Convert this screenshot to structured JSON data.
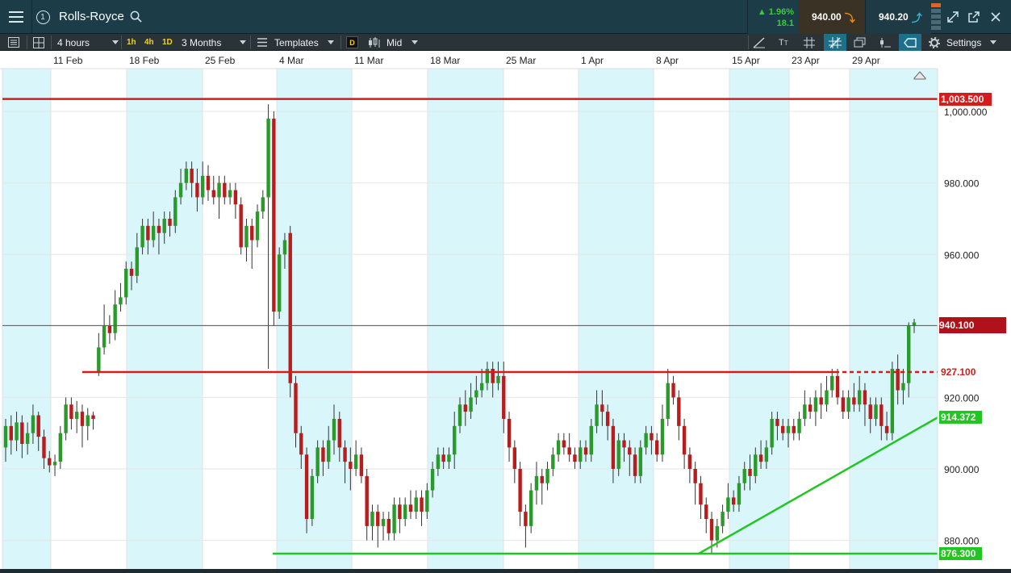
{
  "header": {
    "title": "Rolls-Royce",
    "panel_number": "1",
    "change_pct": "1.96%",
    "change_abs": "18.1",
    "sell_price": "940.00",
    "buy_price": "940.20"
  },
  "toolbar": {
    "timeframe": "4 hours",
    "quick_1h": "1h",
    "quick_4h": "4h",
    "quick_1d": "1D",
    "range": "3 Months",
    "templates": "Templates",
    "d_badge": "D",
    "price_type": "Mid",
    "settings": "Settings"
  },
  "colors": {
    "up": "#2a9a2a",
    "down": "#b91c1c",
    "resistance": "#d71a1a",
    "support": "#22c622",
    "band": "#d9f6fb"
  },
  "chart_data": {
    "type": "candlestick",
    "x_tick_labels": [
      "11 Feb",
      "18 Feb",
      "25 Feb",
      "4 Mar",
      "11 Mar",
      "18 Mar",
      "25 Mar",
      "1 Apr",
      "8 Apr",
      "15 Apr",
      "23 Apr",
      "29 Apr"
    ],
    "y_tick_labels": [
      "880.000",
      "900.000",
      "920.000",
      "940.000",
      "960.000",
      "980.000",
      "1,000.000"
    ],
    "ylim": [
      872,
      1012
    ],
    "current_price": "940.100",
    "level_labels": {
      "top_resistance": "1,003.500",
      "mid_resistance": "927.100",
      "trendline": "914.372",
      "support": "876.300"
    },
    "levels": {
      "top_resistance": 1003.5,
      "mid_resistance": 927.1,
      "support": 876.3,
      "current": 940.1
    },
    "trendline": [
      [
        167,
        876.3
      ],
      [
        230,
        914.372
      ]
    ],
    "candles": [
      [
        906,
        912,
        902,
        914
      ],
      [
        912,
        908,
        904,
        915
      ],
      [
        908,
        913,
        905,
        916
      ],
      [
        913,
        907,
        903,
        915
      ],
      [
        907,
        910,
        904,
        913
      ],
      [
        910,
        915,
        907,
        918
      ],
      [
        915,
        909,
        905,
        916
      ],
      [
        909,
        903,
        900,
        911
      ],
      [
        903,
        901,
        899,
        905
      ],
      [
        901,
        902,
        898,
        904
      ],
      [
        902,
        910,
        900,
        912
      ],
      [
        910,
        918,
        908,
        920
      ],
      [
        918,
        914,
        911,
        920
      ],
      [
        914,
        916,
        910,
        919
      ],
      [
        916,
        912,
        906,
        918
      ],
      [
        912,
        915,
        908,
        917
      ],
      [
        915,
        914,
        911,
        916
      ],
      [
        927,
        934,
        926,
        938
      ],
      [
        934,
        940,
        932,
        946
      ],
      [
        940,
        938,
        935,
        943
      ],
      [
        938,
        946,
        936,
        950
      ],
      [
        946,
        948,
        944,
        952
      ],
      [
        948,
        956,
        946,
        958
      ],
      [
        956,
        954,
        950,
        958
      ],
      [
        954,
        962,
        952,
        966
      ],
      [
        962,
        968,
        960,
        970
      ],
      [
        968,
        964,
        960,
        970
      ],
      [
        964,
        968,
        962,
        972
      ],
      [
        968,
        966,
        960,
        970
      ],
      [
        966,
        970,
        963,
        972
      ],
      [
        970,
        968,
        965,
        972
      ],
      [
        968,
        976,
        966,
        978
      ],
      [
        976,
        980,
        974,
        984
      ],
      [
        980,
        984,
        978,
        986
      ],
      [
        984,
        980,
        976,
        986
      ],
      [
        980,
        976,
        972,
        984
      ],
      [
        976,
        982,
        974,
        986
      ],
      [
        982,
        978,
        975,
        985
      ],
      [
        978,
        976,
        974,
        982
      ],
      [
        976,
        980,
        970,
        982
      ],
      [
        980,
        976,
        974,
        982
      ],
      [
        976,
        978,
        974,
        980
      ],
      [
        978,
        974,
        970,
        980
      ],
      [
        974,
        962,
        960,
        976
      ],
      [
        962,
        968,
        958,
        970
      ],
      [
        968,
        964,
        956,
        970
      ],
      [
        964,
        972,
        962,
        974
      ],
      [
        972,
        976,
        970,
        978
      ],
      [
        976,
        998,
        928,
        1002
      ],
      [
        998,
        944,
        940,
        1000
      ],
      [
        944,
        960,
        942,
        962
      ],
      [
        960,
        964,
        956,
        966
      ],
      [
        966,
        924,
        920,
        968
      ],
      [
        924,
        910,
        906,
        926
      ],
      [
        910,
        904,
        900,
        912
      ],
      [
        904,
        886,
        882,
        906
      ],
      [
        886,
        898,
        884,
        900
      ],
      [
        898,
        906,
        896,
        908
      ],
      [
        906,
        902,
        898,
        908
      ],
      [
        902,
        908,
        900,
        912
      ],
      [
        908,
        914,
        904,
        918
      ],
      [
        914,
        906,
        902,
        916
      ],
      [
        906,
        902,
        896,
        908
      ],
      [
        902,
        900,
        894,
        906
      ],
      [
        900,
        904,
        898,
        908
      ],
      [
        904,
        898,
        896,
        906
      ],
      [
        898,
        884,
        880,
        900
      ],
      [
        884,
        888,
        880,
        890
      ],
      [
        888,
        884,
        878,
        890
      ],
      [
        884,
        886,
        880,
        888
      ],
      [
        886,
        882,
        880,
        888
      ],
      [
        882,
        890,
        880,
        892
      ],
      [
        890,
        886,
        882,
        892
      ],
      [
        886,
        890,
        884,
        892
      ],
      [
        890,
        888,
        886,
        894
      ],
      [
        888,
        892,
        886,
        894
      ],
      [
        892,
        888,
        884,
        894
      ],
      [
        888,
        894,
        886,
        896
      ],
      [
        894,
        900,
        892,
        902
      ],
      [
        900,
        904,
        898,
        906
      ],
      [
        904,
        902,
        900,
        906
      ],
      [
        902,
        904,
        900,
        906
      ],
      [
        904,
        912,
        900,
        916
      ],
      [
        912,
        918,
        910,
        920
      ],
      [
        918,
        916,
        912,
        922
      ],
      [
        916,
        920,
        914,
        924
      ],
      [
        920,
        922,
        918,
        926
      ],
      [
        922,
        924,
        920,
        928
      ],
      [
        924,
        928,
        922,
        930
      ],
      [
        928,
        924,
        920,
        930
      ],
      [
        924,
        926,
        922,
        930
      ],
      [
        926,
        914,
        910,
        930
      ],
      [
        914,
        906,
        902,
        916
      ],
      [
        906,
        900,
        896,
        908
      ],
      [
        900,
        888,
        884,
        902
      ],
      [
        888,
        884,
        878,
        890
      ],
      [
        884,
        894,
        882,
        896
      ],
      [
        894,
        898,
        890,
        902
      ],
      [
        898,
        896,
        890,
        900
      ],
      [
        896,
        900,
        894,
        902
      ],
      [
        900,
        904,
        898,
        906
      ],
      [
        904,
        908,
        902,
        910
      ],
      [
        908,
        906,
        904,
        910
      ],
      [
        906,
        904,
        902,
        910
      ],
      [
        904,
        902,
        900,
        906
      ],
      [
        902,
        906,
        900,
        908
      ],
      [
        906,
        904,
        902,
        908
      ],
      [
        904,
        912,
        902,
        914
      ],
      [
        912,
        918,
        910,
        922
      ],
      [
        918,
        916,
        912,
        922
      ],
      [
        916,
        912,
        908,
        918
      ],
      [
        912,
        900,
        896,
        914
      ],
      [
        900,
        908,
        898,
        910
      ],
      [
        908,
        906,
        902,
        910
      ],
      [
        906,
        904,
        898,
        908
      ],
      [
        904,
        898,
        896,
        906
      ],
      [
        898,
        906,
        896,
        908
      ],
      [
        906,
        910,
        904,
        912
      ],
      [
        910,
        908,
        904,
        912
      ],
      [
        908,
        904,
        902,
        910
      ],
      [
        904,
        914,
        902,
        918
      ],
      [
        914,
        924,
        912,
        928
      ],
      [
        924,
        920,
        918,
        926
      ],
      [
        920,
        912,
        908,
        922
      ],
      [
        912,
        904,
        900,
        914
      ],
      [
        904,
        900,
        896,
        906
      ],
      [
        900,
        896,
        890,
        902
      ],
      [
        896,
        890,
        886,
        898
      ],
      [
        890,
        886,
        882,
        892
      ],
      [
        886,
        880,
        876,
        888
      ],
      [
        880,
        884,
        878,
        886
      ],
      [
        884,
        888,
        882,
        890
      ],
      [
        888,
        892,
        886,
        896
      ],
      [
        892,
        890,
        888,
        894
      ],
      [
        890,
        896,
        888,
        898
      ],
      [
        896,
        900,
        894,
        902
      ],
      [
        900,
        898,
        894,
        904
      ],
      [
        898,
        904,
        896,
        906
      ],
      [
        904,
        902,
        900,
        908
      ],
      [
        902,
        906,
        900,
        908
      ],
      [
        906,
        914,
        904,
        916
      ],
      [
        914,
        912,
        908,
        916
      ],
      [
        912,
        910,
        908,
        914
      ],
      [
        910,
        912,
        906,
        914
      ],
      [
        912,
        910,
        908,
        914
      ],
      [
        910,
        914,
        908,
        916
      ],
      [
        914,
        918,
        912,
        922
      ],
      [
        918,
        916,
        914,
        920
      ],
      [
        916,
        920,
        912,
        922
      ],
      [
        920,
        918,
        914,
        924
      ],
      [
        918,
        922,
        916,
        926
      ],
      [
        922,
        926,
        920,
        928
      ],
      [
        926,
        920,
        918,
        928
      ],
      [
        920,
        916,
        914,
        922
      ],
      [
        916,
        920,
        914,
        922
      ],
      [
        920,
        918,
        916,
        924
      ],
      [
        918,
        922,
        916,
        926
      ],
      [
        922,
        918,
        912,
        924
      ],
      [
        918,
        914,
        910,
        920
      ],
      [
        914,
        918,
        912,
        920
      ],
      [
        918,
        912,
        908,
        920
      ],
      [
        912,
        910,
        908,
        916
      ],
      [
        910,
        928,
        908,
        930
      ],
      [
        928,
        922,
        918,
        932
      ],
      [
        922,
        924,
        918,
        928
      ],
      [
        924,
        940,
        920,
        941
      ],
      [
        940,
        941,
        938,
        942
      ]
    ]
  }
}
